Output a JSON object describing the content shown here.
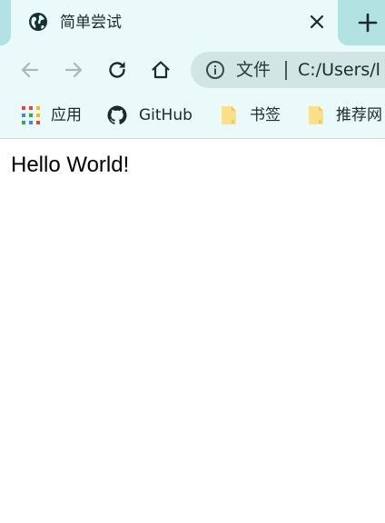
{
  "tab": {
    "title": "简单尝试",
    "favicon": "globe-icon",
    "close_icon": "close-icon"
  },
  "tabstrip": {
    "new_tab_icon": "plus-icon"
  },
  "toolbar": {
    "back_icon": "arrow-left-icon",
    "forward_icon": "arrow-right-icon",
    "reload_icon": "reload-icon",
    "home_icon": "home-icon",
    "omnibox": {
      "info_icon": "info-icon",
      "chip": "文件",
      "url": "C:/Users/l"
    }
  },
  "bookmarks": {
    "items": [
      {
        "label": "应用",
        "icon": "apps-grid-icon"
      },
      {
        "label": "GitHub",
        "icon": "github-icon"
      },
      {
        "label": "书签",
        "icon": "folder-icon"
      },
      {
        "label": "推荐网",
        "icon": "folder-icon"
      }
    ]
  },
  "content": {
    "heading": "Hello World!"
  },
  "colors": {
    "tabstrip": "#b2e2e2",
    "toolbar": "#eafafa",
    "omnibox": "#d2e5e5",
    "text": "#1b2b2b"
  }
}
